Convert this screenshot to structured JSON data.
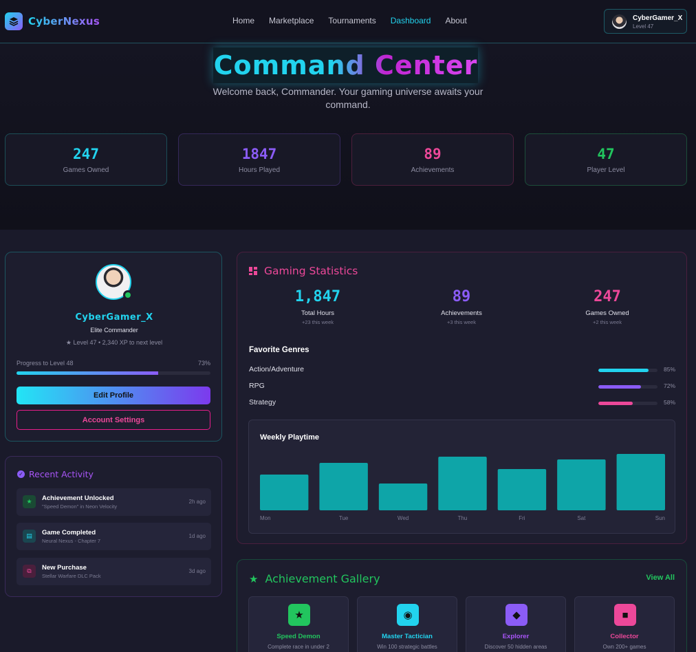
{
  "brand": {
    "name": "CyberNexus",
    "icon": "layers-icon",
    "accent": "#22d3ee",
    "accent2": "#8b5cf6"
  },
  "nav": {
    "links": [
      {
        "label": "Home",
        "active": false
      },
      {
        "label": "Marketplace",
        "active": false
      },
      {
        "label": "Tournaments",
        "active": false
      },
      {
        "label": "Dashboard",
        "active": true
      },
      {
        "label": "About",
        "active": false
      }
    ],
    "user": {
      "name": "CyberGamer_X",
      "level": "Level 47"
    }
  },
  "hero": {
    "title": "Command Center",
    "subtitle": "Welcome back, Commander. Your gaming universe awaits your command.",
    "stats": [
      {
        "value": "247",
        "label": "Games Owned",
        "color": "#22d3ee",
        "border": "#1c4e57"
      },
      {
        "value": "1847",
        "label": "Hours Played",
        "color": "#8b5cf6",
        "border": "#35285a"
      },
      {
        "value": "89",
        "label": "Achievements",
        "color": "#ec4899",
        "border": "#4d1f3c"
      },
      {
        "value": "47",
        "label": "Player Level",
        "color": "#22c55e",
        "border": "#1c4e3a"
      }
    ]
  },
  "profile": {
    "name": "CyberGamer_X",
    "title": "Elite Commander",
    "level_text": "Level 47 • 2,340 XP to next level",
    "progress_label": "Progress to Level 48",
    "progress_pct_text": "73%",
    "progress": 0.73,
    "edit_label": "Edit Profile",
    "account_label": "Account Settings"
  },
  "activity": {
    "title": "Recent Activity",
    "items": [
      {
        "title": "Achievement Unlocked",
        "desc": "\"Speed Demon\" in Neon Velocity",
        "time": "2h ago",
        "icon": "star-icon",
        "color": "#22c55e",
        "bg": "#1a4a34"
      },
      {
        "title": "Game Completed",
        "desc": "Neural Nexus - Chapter 7",
        "time": "1d ago",
        "icon": "document-icon",
        "color": "#22d3ee",
        "bg": "#1a4650"
      },
      {
        "title": "New Purchase",
        "desc": "Stellar Warfare DLC Pack",
        "time": "3d ago",
        "icon": "copy-icon",
        "color": "#ec4899",
        "bg": "#4a1f3c"
      }
    ]
  },
  "gaming_stats": {
    "title": "Gaming Statistics",
    "columns": [
      {
        "value": "1,847",
        "label": "Total Hours",
        "sub": "+23 this week",
        "color": "#22d3ee"
      },
      {
        "value": "89",
        "label": "Achievements",
        "sub": "+3 this week",
        "color": "#8b5cf6"
      },
      {
        "value": "247",
        "label": "Games Owned",
        "sub": "+2 this week",
        "color": "#ec4899"
      }
    ],
    "genres_title": "Favorite Genres",
    "genres": [
      {
        "name": "Action/Adventure",
        "pct_text": "85%",
        "value": 0.85,
        "color": "#22d3ee"
      },
      {
        "name": "RPG",
        "pct_text": "72%",
        "value": 0.72,
        "color": "#8b5cf6"
      },
      {
        "name": "Strategy",
        "pct_text": "58%",
        "value": 0.58,
        "color": "#ec4899"
      }
    ]
  },
  "chart_data": {
    "type": "bar",
    "title": "Weekly Playtime",
    "categories": [
      "Mon",
      "Tue",
      "Wed",
      "Thu",
      "Fri",
      "Sat",
      "Sun"
    ],
    "values": [
      52,
      69,
      39,
      78,
      60,
      74,
      82
    ],
    "ylim": [
      0,
      100
    ],
    "color": "#0ea5a8",
    "grid": false
  },
  "achievements": {
    "title": "Achievement Gallery",
    "view_all": "View All",
    "items": [
      {
        "name": "Speed Demon",
        "desc": "Complete race in under 2",
        "icon": "star-icon",
        "color": "#22c55e"
      },
      {
        "name": "Master Tactician",
        "desc": "Win 100 strategic battles",
        "icon": "compass-icon",
        "color": "#22d3ee"
      },
      {
        "name": "Explorer",
        "desc": "Discover 50 hidden areas",
        "icon": "map-icon",
        "color": "#8b5cf6"
      },
      {
        "name": "Collector",
        "desc": "Own 200+ games",
        "icon": "box-icon",
        "color": "#ec4899"
      }
    ]
  }
}
